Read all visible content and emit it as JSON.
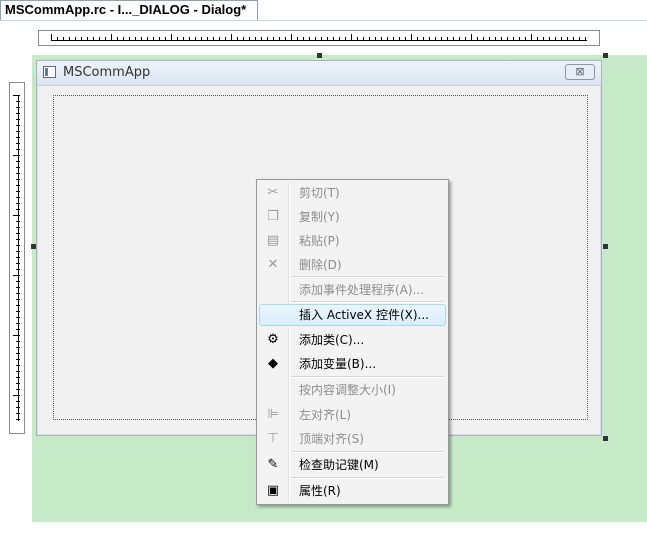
{
  "tab": {
    "title": "MSCommApp.rc - I..._DIALOG - Dialog*"
  },
  "dialog": {
    "title": "MSCommApp",
    "close_glyph": "⊠"
  },
  "colors": {
    "surface": "#c6eac7",
    "highlight": "#d9eefb"
  },
  "context_menu": {
    "items": [
      {
        "label": "剪切(T)",
        "icon": "scissors-icon",
        "glyph": "✂",
        "enabled": false
      },
      {
        "label": "复制(Y)",
        "icon": "copy-icon",
        "glyph": "❐",
        "enabled": false
      },
      {
        "label": "粘贴(P)",
        "icon": "paste-icon",
        "glyph": "▤",
        "enabled": false
      },
      {
        "label": "删除(D)",
        "icon": "delete-icon",
        "glyph": "✕",
        "enabled": false
      },
      {
        "label": "添加事件处理程序(A)...",
        "icon": "",
        "glyph": "",
        "enabled": false
      },
      {
        "label": "插入 ActiveX 控件(X)...",
        "icon": "",
        "glyph": "",
        "enabled": true,
        "highlighted": true
      },
      {
        "label": "添加类(C)...",
        "icon": "add-class-icon",
        "glyph": "⚙",
        "enabled": true
      },
      {
        "label": "添加变量(B)...",
        "icon": "add-variable-icon",
        "glyph": "◆",
        "enabled": true
      },
      {
        "label": "按内容调整大小(I)",
        "icon": "",
        "glyph": "",
        "enabled": false
      },
      {
        "label": "左对齐(L)",
        "icon": "align-left-icon",
        "glyph": "⊫",
        "enabled": false
      },
      {
        "label": "顶端对齐(S)",
        "icon": "align-top-icon",
        "glyph": "⊤",
        "enabled": false
      },
      {
        "label": "检查助记键(M)",
        "icon": "check-mnemonics-icon",
        "glyph": "✎",
        "enabled": true
      },
      {
        "label": "属性(R)",
        "icon": "properties-icon",
        "glyph": "▣",
        "enabled": true
      }
    ]
  }
}
